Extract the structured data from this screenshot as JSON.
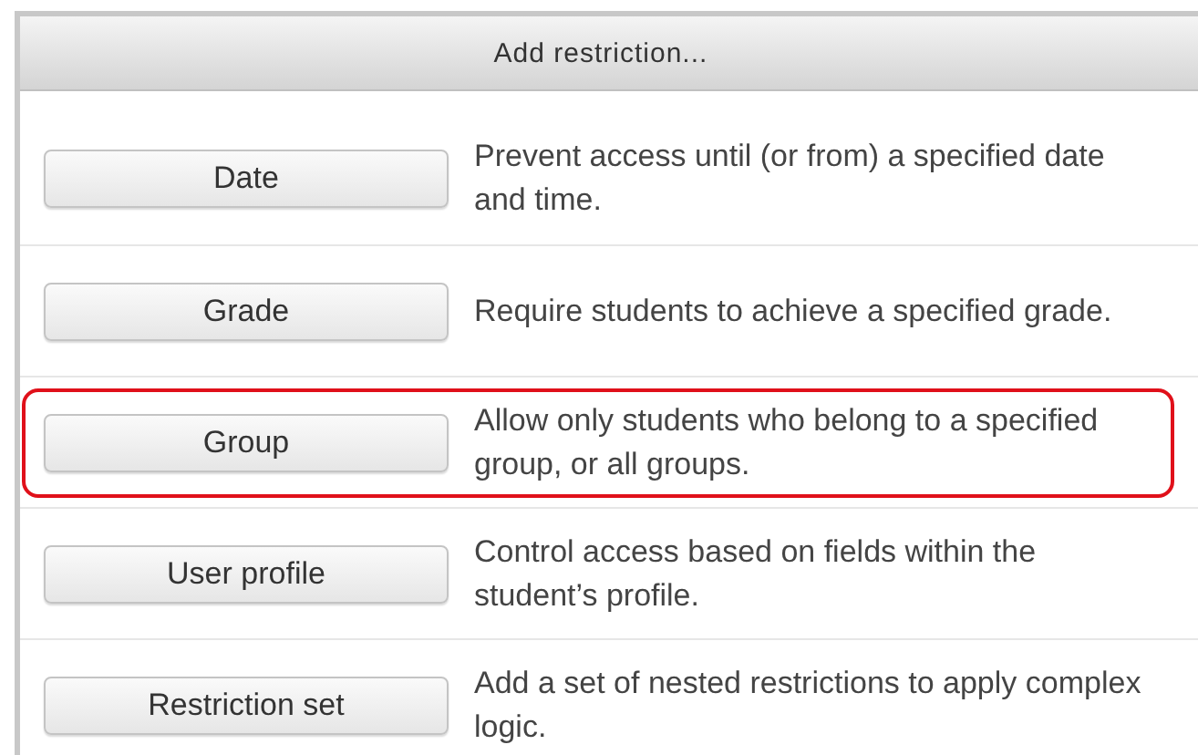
{
  "dialog": {
    "title": "Add restriction..."
  },
  "options": [
    {
      "label": "Date",
      "description": "Prevent access until (or from) a specified date and time.",
      "highlighted": false
    },
    {
      "label": "Grade",
      "description": "Require students to achieve a specified grade.",
      "highlighted": false
    },
    {
      "label": "Group",
      "description": "Allow only students who belong to a specified group, or all groups.",
      "highlighted": true
    },
    {
      "label": "User profile",
      "description": "Control access based on fields within the student’s profile.",
      "highlighted": false
    },
    {
      "label": "Restriction set",
      "description": "Add a set of nested restrictions to apply complex logic.",
      "highlighted": false
    }
  ]
}
